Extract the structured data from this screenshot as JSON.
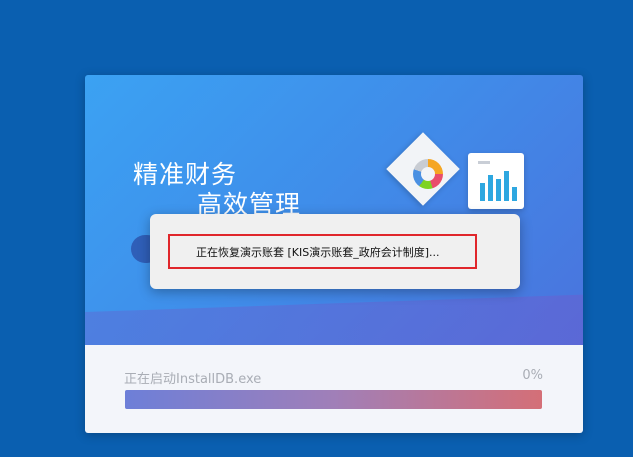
{
  "banner": {
    "slogan_line1": "精准财务",
    "slogan_line2": "高效管理"
  },
  "footer": {
    "status_text": "正在启动InstallDB.exe",
    "progress_percent_label": "0%",
    "progress_fraction": 1.0
  },
  "dialog": {
    "message": "正在恢复演示账套 [KIS演示账套_政府会计制度]..."
  },
  "colors": {
    "desktop": "#0a5fb0",
    "highlight_border": "#e0262b"
  },
  "icons": [
    "donut-chart-icon",
    "bar-chart-icon"
  ]
}
